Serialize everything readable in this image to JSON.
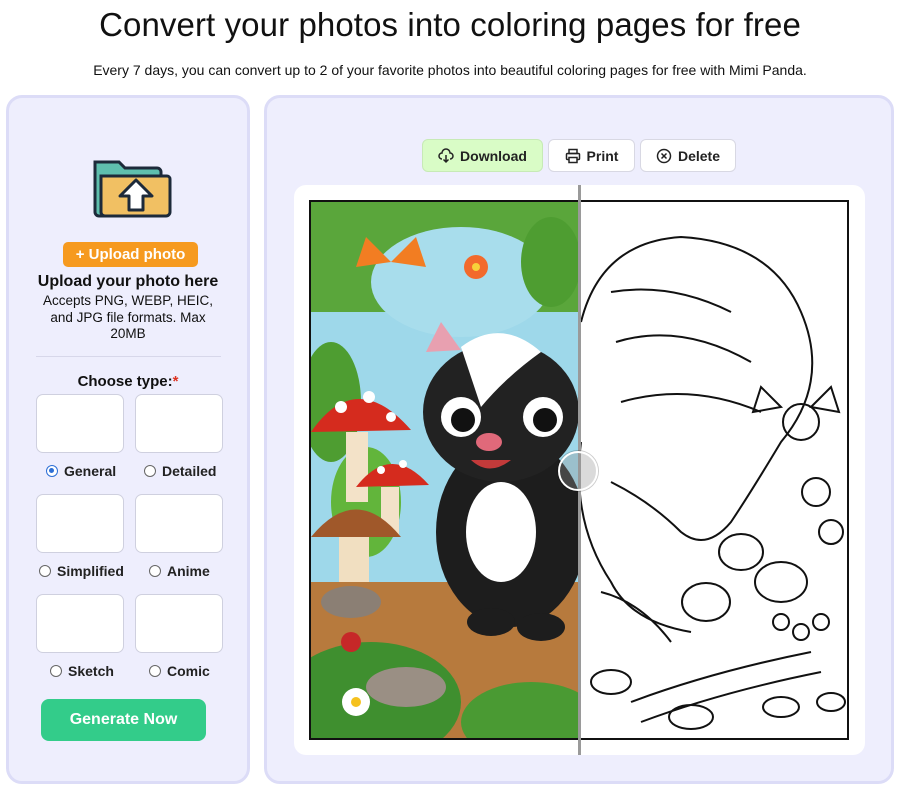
{
  "header": {
    "title": "Convert your photos into coloring pages for free",
    "subtitle": "Every 7 days, you can convert up to 2 of your favorite photos into beautiful coloring pages for free with Mimi Panda."
  },
  "upload": {
    "button_label": "+ Upload photo",
    "title": "Upload your photo here",
    "description": "Accepts PNG, WEBP, HEIC, and JPG file formats. Max 20MB"
  },
  "types": {
    "heading": "Choose type:",
    "required_mark": "*",
    "selected": "General",
    "options": [
      {
        "label": "General",
        "checked": true
      },
      {
        "label": "Detailed",
        "checked": false
      },
      {
        "label": "Simplified",
        "checked": false
      },
      {
        "label": "Anime",
        "checked": false
      },
      {
        "label": "Sketch",
        "checked": false
      },
      {
        "label": "Comic",
        "checked": false
      }
    ]
  },
  "actions": {
    "generate_label": "Generate Now"
  },
  "toolbar": {
    "download_label": "Download",
    "print_label": "Print",
    "delete_label": "Delete"
  },
  "colors": {
    "panel_bg": "#eeeefd",
    "panel_border": "#dcdcf7",
    "upload_orange": "#f69a1f",
    "generate_green": "#33cc8a",
    "download_bg": "#d9fcc6",
    "radio_blue": "#2d6fd6"
  }
}
